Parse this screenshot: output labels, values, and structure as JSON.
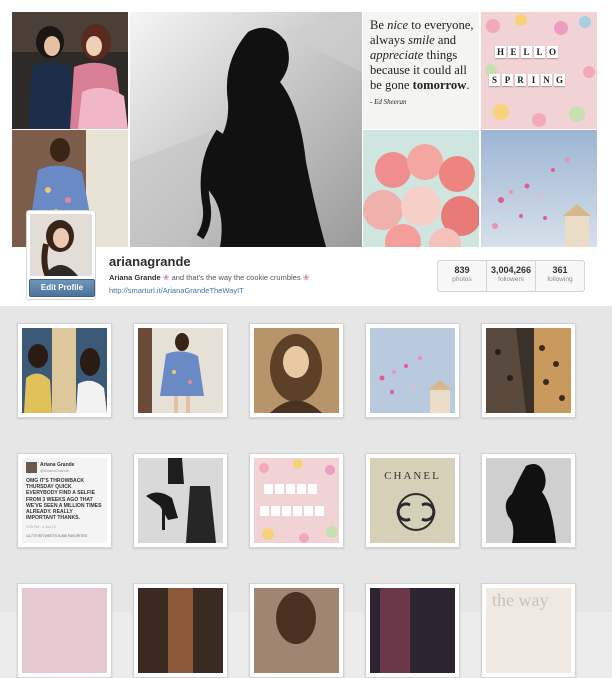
{
  "profile": {
    "username": "arianagrande",
    "full_name": "Ariana Grande",
    "bio": "and that's the way the cookie crumbles",
    "website": "http://smarturl.it/ArianaGrandeTheWayIT",
    "edit_button": "Edit Profile"
  },
  "stats": [
    {
      "value": "839",
      "label": "photos"
    },
    {
      "value": "3,004,266",
      "label": "followers"
    },
    {
      "value": "361",
      "label": "following"
    }
  ],
  "collage": {
    "quote": {
      "l1a": "Be ",
      "l1b": "nice",
      "l1c": " to everyone,",
      "l2a": "always ",
      "l2b": "smile",
      "l2c": " and",
      "l3a": "appreciate",
      "l3b": " things",
      "l4": "because it could all",
      "l5a": "be gone ",
      "l5b": "tomorrow",
      "author": "- Ed Sheeran"
    },
    "hello_letters": [
      "H",
      "E",
      "L",
      "L",
      "O"
    ],
    "spring_letters": [
      "S",
      "P",
      "R",
      "I",
      "N",
      "G"
    ]
  },
  "grid": {
    "tweet": {
      "name": "Ariana Grande",
      "handle": "@ArianaGrande",
      "text": "OMG IT'S THROWBACK THURSDAY QUICK EVERYBODY FIND A SELFIE FROM 3 WEEKS AGO THAT WE'VE SEEN A MILLION TIMES ALREADY. REALLY IMPORTANT THANKS.",
      "date": "4:09 PM - 4 Jun 13",
      "counts": "14,775 RETWEETS  8,086 FAVORITES"
    },
    "chanel": "CHANEL",
    "partial_text": "the way"
  },
  "colors": {
    "link": "#3e77a8",
    "button": "#4c739b",
    "flower": "#d98aa0"
  },
  "icons": [
    "flower-icon"
  ]
}
